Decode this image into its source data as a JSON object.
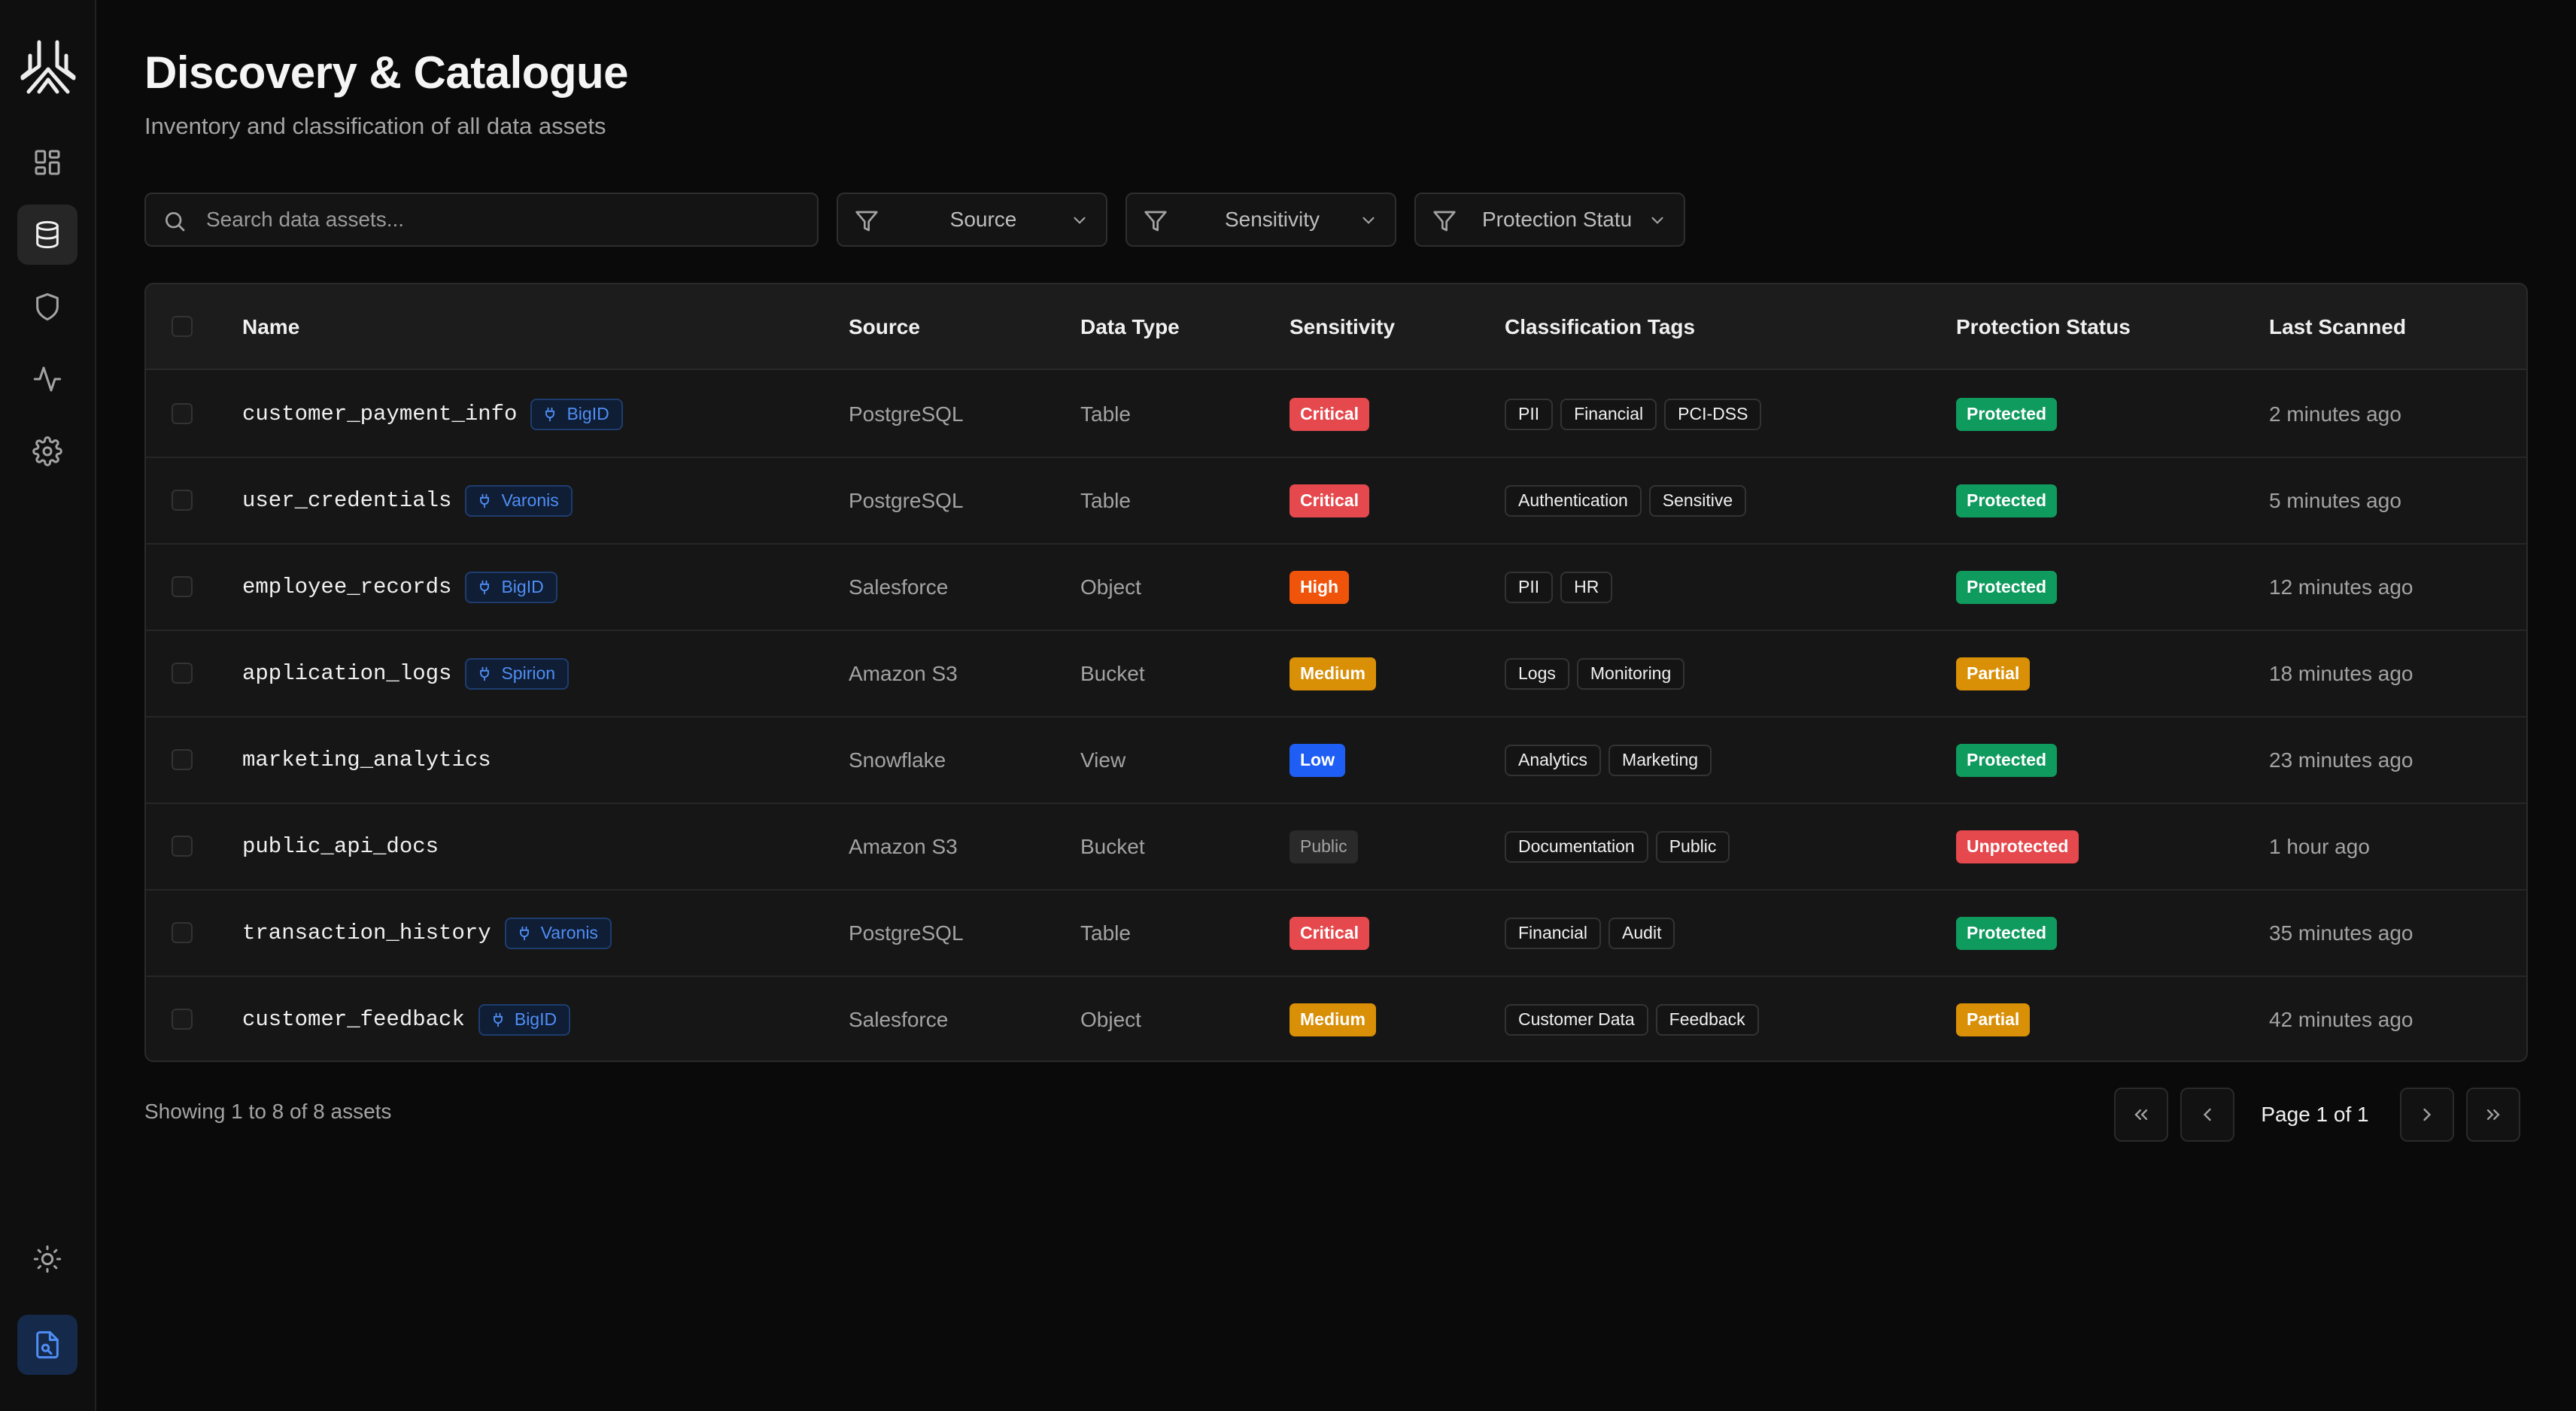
{
  "colors": {
    "critical": "#e5484d",
    "high": "#f0530a",
    "medium": "#d98f06",
    "low": "#1f5ef5",
    "public": "#2a2a2a",
    "protected": "#0f9a5e",
    "partial": "#d98f06",
    "unprotected": "#e5484d",
    "accent": "#4f8ef5"
  },
  "sidebar": {
    "items": [
      {
        "icon": "dashboard-icon"
      },
      {
        "icon": "database-icon",
        "active": true
      },
      {
        "icon": "shield-icon"
      },
      {
        "icon": "activity-icon"
      },
      {
        "icon": "gear-icon"
      }
    ],
    "bottom": [
      {
        "icon": "sun-icon"
      },
      {
        "icon": "file-search-icon"
      }
    ]
  },
  "header": {
    "title": "Discovery & Catalogue",
    "subtitle": "Inventory and classification of all data assets"
  },
  "search": {
    "placeholder": "Search data assets..."
  },
  "filters": [
    {
      "label": "Source"
    },
    {
      "label": "Sensitivity"
    },
    {
      "label": "Protection Status"
    }
  ],
  "table": {
    "columns": [
      "Name",
      "Source",
      "Data Type",
      "Sensitivity",
      "Classification Tags",
      "Protection Status",
      "Last Scanned"
    ],
    "rows": [
      {
        "name": "customer_payment_info",
        "tool": "BigID",
        "source": "PostgreSQL",
        "type": "Table",
        "sensitivity": "Critical",
        "tags": [
          "PII",
          "Financial",
          "PCI-DSS"
        ],
        "protection": "Protected",
        "scanned": "2 minutes ago"
      },
      {
        "name": "user_credentials",
        "tool": "Varonis",
        "source": "PostgreSQL",
        "type": "Table",
        "sensitivity": "Critical",
        "tags": [
          "Authentication",
          "Sensitive"
        ],
        "protection": "Protected",
        "scanned": "5 minutes ago"
      },
      {
        "name": "employee_records",
        "tool": "BigID",
        "source": "Salesforce",
        "type": "Object",
        "sensitivity": "High",
        "tags": [
          "PII",
          "HR"
        ],
        "protection": "Protected",
        "scanned": "12 minutes ago"
      },
      {
        "name": "application_logs",
        "tool": "Spirion",
        "source": "Amazon S3",
        "type": "Bucket",
        "sensitivity": "Medium",
        "tags": [
          "Logs",
          "Monitoring"
        ],
        "protection": "Partial",
        "scanned": "18 minutes ago"
      },
      {
        "name": "marketing_analytics",
        "tool": "",
        "source": "Snowflake",
        "type": "View",
        "sensitivity": "Low",
        "tags": [
          "Analytics",
          "Marketing"
        ],
        "protection": "Protected",
        "scanned": "23 minutes ago"
      },
      {
        "name": "public_api_docs",
        "tool": "",
        "source": "Amazon S3",
        "type": "Bucket",
        "sensitivity": "Public",
        "tags": [
          "Documentation",
          "Public"
        ],
        "protection": "Unprotected",
        "scanned": "1 hour ago"
      },
      {
        "name": "transaction_history",
        "tool": "Varonis",
        "source": "PostgreSQL",
        "type": "Table",
        "sensitivity": "Critical",
        "tags": [
          "Financial",
          "Audit"
        ],
        "protection": "Protected",
        "scanned": "35 minutes ago"
      },
      {
        "name": "customer_feedback",
        "tool": "BigID",
        "source": "Salesforce",
        "type": "Object",
        "sensitivity": "Medium",
        "tags": [
          "Customer Data",
          "Feedback"
        ],
        "protection": "Partial",
        "scanned": "42 minutes ago"
      }
    ]
  },
  "footer": {
    "showing": "Showing 1 to 8 of 8 assets",
    "page_label": "Page 1 of 1"
  }
}
